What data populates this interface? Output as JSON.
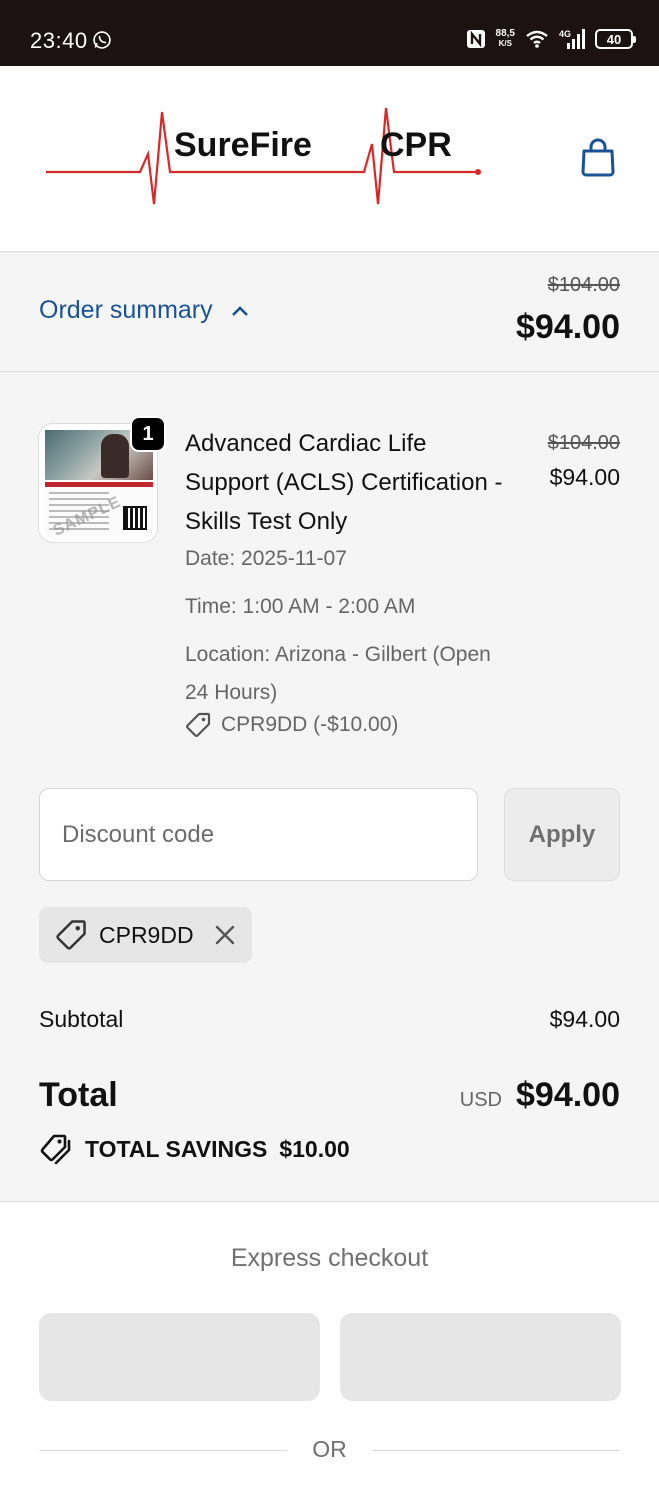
{
  "status_bar": {
    "time": "23:40",
    "net_speed_value": "88,5",
    "net_speed_unit": "K/S",
    "network_type": "4G",
    "battery": "40",
    "icons": [
      "whatsapp-icon",
      "nfc-icon",
      "wifi-icon",
      "signal-icon",
      "battery-icon"
    ]
  },
  "header": {
    "logo_text_left": "SureFire",
    "logo_text_right": "CPR",
    "cart_icon": "shopping-bag-icon"
  },
  "summary": {
    "toggle_label": "Order summary",
    "original_price": "$104.00",
    "price": "$94.00"
  },
  "item": {
    "quantity": "1",
    "title": "Advanced Cardiac Life Support (ACLS) Certification - Skills Test Only",
    "original_price": "$104.00",
    "price": "$94.00",
    "date": "Date: 2025-11-07",
    "time": "Time: 1:00 AM - 2:00 AM",
    "location": "Location: Arizona - Gilbert (Open 24 Hours)",
    "discount": "CPR9DD (-$10.00)",
    "thumb_watermark": "SAMPLE"
  },
  "discount": {
    "placeholder": "Discount code",
    "value": "",
    "apply_label": "Apply",
    "applied_code": "CPR9DD"
  },
  "totals": {
    "subtotal_label": "Subtotal",
    "subtotal": "$94.00",
    "total_label": "Total",
    "currency": "USD",
    "total": "$94.00",
    "savings_label": "TOTAL SAVINGS",
    "savings": "$10.00"
  },
  "express": {
    "title": "Express checkout",
    "or_label": "OR"
  },
  "colors": {
    "status_bar_bg": "#1c1212",
    "link_blue": "#1a5296",
    "panel_bg": "#f5f5f5",
    "logo_red": "#d62a2a"
  }
}
